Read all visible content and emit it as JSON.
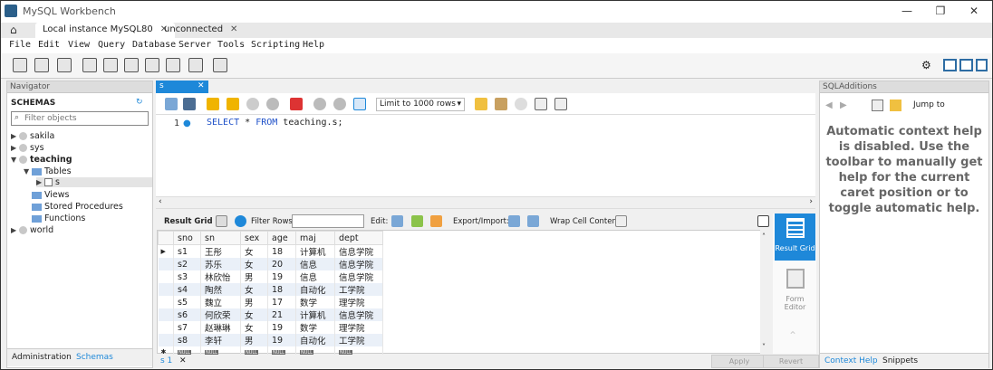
{
  "window": {
    "title": "MySQL Workbench"
  },
  "tabs": [
    {
      "label": "Local instance MySQL80"
    },
    {
      "label": "unconnected"
    }
  ],
  "menu": [
    "File",
    "Edit",
    "View",
    "Query",
    "Database",
    "Server",
    "Tools",
    "Scripting",
    "Help"
  ],
  "navigator": {
    "header": "Navigator",
    "schemas_label": "SCHEMAS",
    "filter_placeholder": "Filter objects",
    "tree": {
      "sakila": "sakila",
      "sys": "sys",
      "teaching": "teaching",
      "tables": "Tables",
      "s": "s",
      "views": "Views",
      "procs": "Stored Procedures",
      "funcs": "Functions",
      "world": "world"
    },
    "tab_admin": "Administration",
    "tab_schemas": "Schemas"
  },
  "query_tab": {
    "label": "s",
    "close": "✕"
  },
  "query_toolbar": {
    "limit": "Limit to 1000 rows"
  },
  "editor": {
    "line": "1",
    "sql_keyword1": "SELECT",
    "sql_mid": " * ",
    "sql_keyword2": "FROM",
    "sql_rest": " teaching.s;"
  },
  "result": {
    "grid_label": "Result Grid",
    "filter_label": "Filter Rows:",
    "edit_label": "Edit:",
    "export_label": "Export/Import:",
    "wrap_label": "Wrap Cell Content:",
    "columns": [
      "sno",
      "sn",
      "sex",
      "age",
      "maj",
      "dept"
    ],
    "rows": [
      [
        "s1",
        "王彤",
        "女",
        "18",
        "计算机",
        "信息学院"
      ],
      [
        "s2",
        "苏乐",
        "女",
        "20",
        "信息",
        "信息学院"
      ],
      [
        "s3",
        "林欣怡",
        "男",
        "19",
        "信息",
        "信息学院"
      ],
      [
        "s4",
        "陶然",
        "女",
        "18",
        "自动化",
        "工学院"
      ],
      [
        "s5",
        "魏立",
        "男",
        "17",
        "数学",
        "理学院"
      ],
      [
        "s6",
        "何欣荣",
        "女",
        "21",
        "计算机",
        "信息学院"
      ],
      [
        "s7",
        "赵琳琳",
        "女",
        "19",
        "数学",
        "理学院"
      ],
      [
        "s8",
        "李轩",
        "男",
        "19",
        "自动化",
        "工学院"
      ]
    ],
    "null_marker": "NULL"
  },
  "side": {
    "result_grid": "Result Grid",
    "form_editor": "Form Editor"
  },
  "bottom": {
    "tab": "s 1",
    "close": "✕",
    "apply": "Apply",
    "revert": "Revert"
  },
  "sqladditions": {
    "header": "SQLAdditions",
    "jump": "Jump to",
    "help": "Automatic context help is disabled. Use the toolbar to manually get help for the current caret position or to toggle automatic help.",
    "tab_context": "Context Help",
    "tab_snippets": "Snippets"
  },
  "colors": {
    "accent": "#1e88d9",
    "keyword": "#1e50c8"
  }
}
